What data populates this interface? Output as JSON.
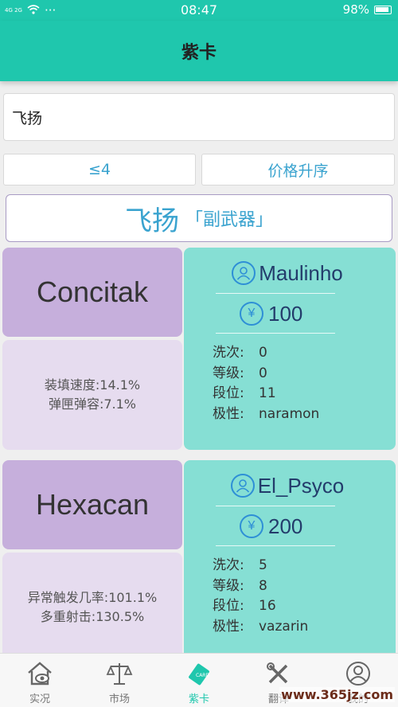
{
  "status": {
    "time": "08:47",
    "battery": "98%",
    "network": "4G 2G",
    "dots": "···"
  },
  "header": {
    "title": "紫卡"
  },
  "search": {
    "value": "飞扬"
  },
  "filters": {
    "level": "≤4",
    "sort": "价格升序"
  },
  "item": {
    "name": "飞扬",
    "type": "「副武器」"
  },
  "cards": [
    {
      "riven_name": "Concitak",
      "stats": [
        "装填速度:14.1%",
        "弹匣弹容:7.1%"
      ],
      "seller": "Maulinho",
      "price": "100",
      "details": [
        {
          "k": "洗次:",
          "v": "0"
        },
        {
          "k": "等级:",
          "v": "0"
        },
        {
          "k": "段位:",
          "v": "11"
        },
        {
          "k": "极性:",
          "v": "naramon"
        }
      ]
    },
    {
      "riven_name": "Hexacan",
      "stats": [
        "异常触发几率:101.1%",
        "多重射击:130.5%"
      ],
      "seller": "El_Psyco",
      "price": "200",
      "details": [
        {
          "k": "洗次:",
          "v": "5"
        },
        {
          "k": "等级:",
          "v": "8"
        },
        {
          "k": "段位:",
          "v": "16"
        },
        {
          "k": "极性:",
          "v": "vazarin"
        }
      ]
    }
  ],
  "tabs": [
    {
      "label": "实况",
      "icon": "house-eye-icon"
    },
    {
      "label": "市场",
      "icon": "scale-icon"
    },
    {
      "label": "紫卡",
      "icon": "card-icon",
      "active": true
    },
    {
      "label": "翻译",
      "icon": "tools-icon"
    },
    {
      "label": "我的",
      "icon": "user-icon"
    }
  ],
  "watermark": "www.365jz.com",
  "colors": {
    "accent": "#1fc7ad",
    "card_purple": "#c6afdc",
    "card_light": "#e6dcef",
    "card_teal": "#86dfd4",
    "link_blue": "#3aa3cf"
  }
}
